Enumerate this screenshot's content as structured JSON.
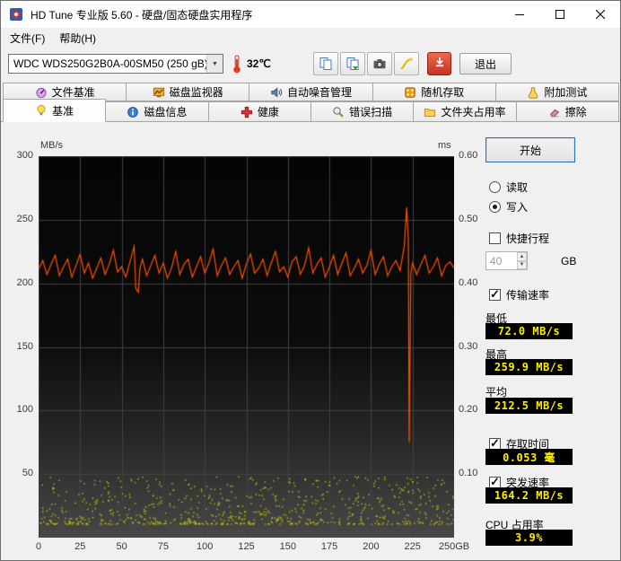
{
  "window": {
    "title": "HD Tune 专业版 5.60 - 硬盘/固态硬盘实用程序"
  },
  "menu": {
    "items": [
      {
        "id": "file",
        "label": "文件(F)"
      },
      {
        "id": "help",
        "label": "帮助(H)"
      }
    ]
  },
  "toolbar": {
    "drive_select": {
      "value": "WDC WDS250G2B0A-00SM50 (250 gB)"
    },
    "temperature": "32℃",
    "buttons": [
      {
        "id": "copy-clipboard",
        "icon": "copy-icon"
      },
      {
        "id": "copy-file",
        "icon": "pages-green-icon"
      },
      {
        "id": "screenshot",
        "icon": "camera-icon"
      },
      {
        "id": "highlight",
        "icon": "wand-icon"
      },
      {
        "id": "update",
        "icon": "download-icon"
      }
    ],
    "exit_label": "退出"
  },
  "tabs": {
    "row1": [
      {
        "id": "file-benchmark",
        "label": "文件基准",
        "icon": "file-benchmark-icon"
      },
      {
        "id": "disk-monitor",
        "label": "磁盘监视器",
        "icon": "disk-monitor-icon"
      },
      {
        "id": "aam",
        "label": "自动噪音管理",
        "icon": "speaker-icon"
      },
      {
        "id": "random-access",
        "label": "随机存取",
        "icon": "random-access-icon"
      },
      {
        "id": "extra-tests",
        "label": "附加测试",
        "icon": "extra-tests-icon"
      }
    ],
    "row2": [
      {
        "id": "benchmark",
        "label": "基准",
        "icon": "benchmark-icon",
        "active": true
      },
      {
        "id": "disk-info",
        "label": "磁盘信息",
        "icon": "disk-info-icon"
      },
      {
        "id": "health",
        "label": "健康",
        "icon": "health-icon"
      },
      {
        "id": "error-scan",
        "label": "错误扫描",
        "icon": "error-scan-icon"
      },
      {
        "id": "folder-usage",
        "label": "文件夹占用率",
        "icon": "folder-icon"
      },
      {
        "id": "erase",
        "label": "擦除",
        "icon": "erase-icon"
      }
    ]
  },
  "controls": {
    "start_label": "开始",
    "read_label": "读取",
    "write_label": "写入",
    "read_selected": false,
    "write_selected": true,
    "short_stroke_label": "快捷行程",
    "short_stroke_checked": false,
    "capacity_value": "40",
    "capacity_unit": "GB",
    "transfer_label": "传输速率",
    "transfer_checked": true,
    "min_label": "最低",
    "min_value": "72.0 MB/s",
    "max_label": "最高",
    "max_value": "259.9 MB/s",
    "avg_label": "平均",
    "avg_value": "212.5 MB/s",
    "access_label": "存取时间",
    "access_checked": true,
    "access_value": "0.053 毫",
    "burst_label": "突发速率",
    "burst_checked": true,
    "burst_value": "164.2 MB/s",
    "cpu_label": "CPU 占用率",
    "cpu_value": "3.9%"
  },
  "chart_data": {
    "type": "line+scatter",
    "title": "",
    "x_axis": {
      "label": "GB",
      "min": 0,
      "max": 250,
      "ticks": [
        0,
        25,
        50,
        75,
        100,
        125,
        150,
        175,
        200,
        225
      ],
      "last_tick_label": "250GB"
    },
    "left_axis": {
      "label": "MB/s",
      "min": 0,
      "max": 300,
      "ticks": [
        300,
        250,
        200,
        150,
        100,
        50
      ]
    },
    "right_axis": {
      "label": "ms",
      "min": 0,
      "max": 0.6,
      "ticks": [
        "0.60",
        "0.50",
        "0.40",
        "0.30",
        "0.20",
        "0.10"
      ]
    },
    "grid": true,
    "background": {
      "top": "#050505",
      "bottom": "#484848"
    },
    "series": [
      {
        "name": "写入传输速率",
        "type": "line",
        "axis": "left",
        "color": "#ff5000",
        "points": [
          [
            0,
            211
          ],
          [
            2.5,
            218
          ],
          [
            5,
            207
          ],
          [
            7.5,
            215
          ],
          [
            10,
            222
          ],
          [
            12.5,
            206
          ],
          [
            15,
            213
          ],
          [
            17.5,
            219
          ],
          [
            20,
            205
          ],
          [
            22.5,
            214
          ],
          [
            25,
            223
          ],
          [
            27.5,
            208
          ],
          [
            30,
            216
          ],
          [
            32.5,
            204
          ],
          [
            35,
            212
          ],
          [
            37.5,
            220
          ],
          [
            40,
            207
          ],
          [
            42.5,
            215
          ],
          [
            45,
            226
          ],
          [
            47.5,
            209
          ],
          [
            50,
            213
          ],
          [
            52.5,
            205
          ],
          [
            55,
            217
          ],
          [
            57.5,
            229
          ],
          [
            58.5,
            196
          ],
          [
            60,
            193
          ],
          [
            61,
            212
          ],
          [
            62.5,
            219
          ],
          [
            65,
            206
          ],
          [
            67.5,
            214
          ],
          [
            70,
            222
          ],
          [
            72.5,
            208
          ],
          [
            75,
            216
          ],
          [
            77.5,
            204
          ],
          [
            80,
            212
          ],
          [
            82.5,
            225
          ],
          [
            85,
            207
          ],
          [
            87.5,
            215
          ],
          [
            90,
            219
          ],
          [
            92.5,
            205
          ],
          [
            95,
            213
          ],
          [
            97.5,
            221
          ],
          [
            100,
            208
          ],
          [
            102.5,
            216
          ],
          [
            105,
            227
          ],
          [
            107.5,
            206
          ],
          [
            110,
            214
          ],
          [
            112.5,
            220
          ],
          [
            115,
            207
          ],
          [
            117.5,
            213
          ],
          [
            120,
            218
          ],
          [
            122.5,
            204
          ],
          [
            125,
            215
          ],
          [
            127.5,
            223
          ],
          [
            130,
            208
          ],
          [
            132.5,
            212
          ],
          [
            135,
            219
          ],
          [
            137.5,
            206
          ],
          [
            140,
            216
          ],
          [
            142.5,
            225
          ],
          [
            145,
            209
          ],
          [
            147.5,
            213
          ],
          [
            150,
            205
          ],
          [
            152.5,
            217
          ],
          [
            155,
            221
          ],
          [
            157.5,
            207
          ],
          [
            160,
            214
          ],
          [
            162.5,
            228
          ],
          [
            165,
            208
          ],
          [
            167.5,
            215
          ],
          [
            170,
            220
          ],
          [
            172.5,
            205
          ],
          [
            175,
            213
          ],
          [
            177.5,
            222
          ],
          [
            180,
            207
          ],
          [
            182.5,
            216
          ],
          [
            185,
            224
          ],
          [
            187.5,
            206
          ],
          [
            190,
            212
          ],
          [
            192.5,
            219
          ],
          [
            195,
            208
          ],
          [
            197.5,
            214
          ],
          [
            200,
            226
          ],
          [
            202.5,
            207
          ],
          [
            205,
            215
          ],
          [
            207.5,
            221
          ],
          [
            210,
            206
          ],
          [
            212.5,
            213
          ],
          [
            215,
            218
          ],
          [
            217.5,
            210
          ],
          [
            220,
            229
          ],
          [
            221.5,
            260
          ],
          [
            222.5,
            234
          ],
          [
            223,
            75
          ],
          [
            224,
            208
          ],
          [
            225,
            216
          ],
          [
            227.5,
            207
          ],
          [
            230,
            215
          ],
          [
            232.5,
            222
          ],
          [
            235,
            208
          ],
          [
            237.5,
            213
          ],
          [
            240,
            220
          ],
          [
            242.5,
            206
          ],
          [
            245,
            214
          ],
          [
            247.5,
            217
          ],
          [
            250,
            212
          ]
        ]
      },
      {
        "name": "存取时间",
        "type": "scatter",
        "axis": "right",
        "color": "#cccc00",
        "scatter_summary": {
          "count": 750,
          "x_min": 0,
          "x_max": 250,
          "y_min_ms": 0.022,
          "y_max_ms": 0.097,
          "mean_ms": 0.053,
          "seed": 13
        }
      }
    ],
    "stats": {
      "min_mbs": 72.0,
      "max_mbs": 259.9,
      "avg_mbs": 212.5,
      "access_ms": 0.053,
      "burst_mbs": 164.2,
      "cpu_pct": 3.9
    }
  }
}
